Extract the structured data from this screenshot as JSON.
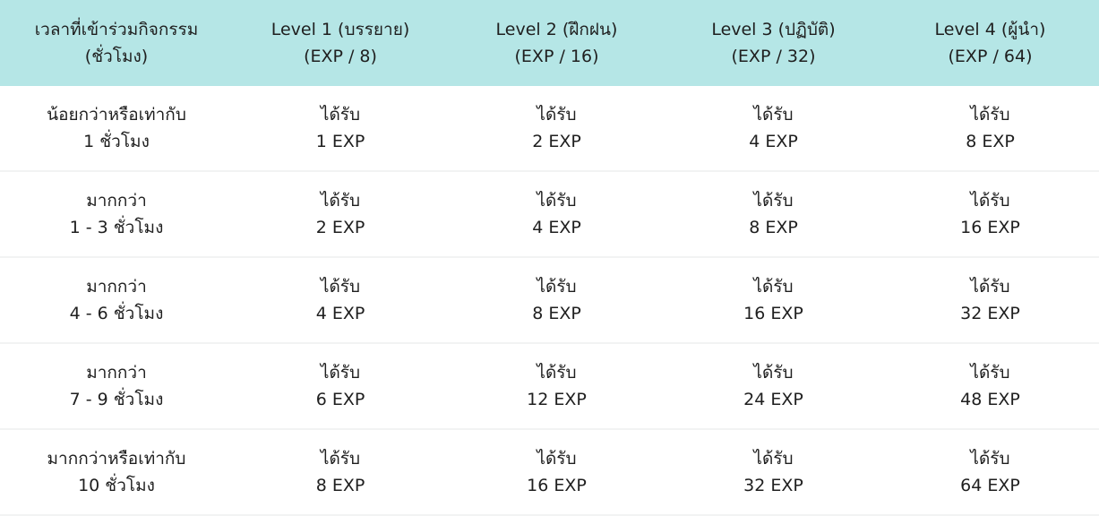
{
  "header": [
    {
      "line1": "เวลาที่เข้าร่วมกิจกรรม",
      "line2": "(ชั่วโมง)"
    },
    {
      "line1": "Level 1 (บรรยาย)",
      "line2": "(EXP / 8)"
    },
    {
      "line1": "Level 2 (ฝึกฝน)",
      "line2": "(EXP / 16)"
    },
    {
      "line1": "Level 3 (ปฏิบัติ)",
      "line2": "(EXP / 32)"
    },
    {
      "line1": "Level 4 (ผู้นำ)",
      "line2": "(EXP / 64)"
    }
  ],
  "rows": [
    {
      "duration": {
        "line1": "น้อยกว่าหรือเท่ากับ",
        "line2": "1 ชั่วโมง"
      },
      "cells": [
        {
          "line1": "ได้รับ",
          "line2": "1 EXP"
        },
        {
          "line1": "ได้รับ",
          "line2": "2 EXP"
        },
        {
          "line1": "ได้รับ",
          "line2": "4 EXP"
        },
        {
          "line1": "ได้รับ",
          "line2": "8 EXP"
        }
      ]
    },
    {
      "duration": {
        "line1": "มากกว่า",
        "line2": "1 - 3 ชั่วโมง"
      },
      "cells": [
        {
          "line1": "ได้รับ",
          "line2": "2 EXP"
        },
        {
          "line1": "ได้รับ",
          "line2": "4 EXP"
        },
        {
          "line1": "ได้รับ",
          "line2": "8 EXP"
        },
        {
          "line1": "ได้รับ",
          "line2": "16 EXP"
        }
      ]
    },
    {
      "duration": {
        "line1": "มากกว่า",
        "line2": "4 - 6 ชั่วโมง"
      },
      "cells": [
        {
          "line1": "ได้รับ",
          "line2": "4 EXP"
        },
        {
          "line1": "ได้รับ",
          "line2": "8 EXP"
        },
        {
          "line1": "ได้รับ",
          "line2": "16 EXP"
        },
        {
          "line1": "ได้รับ",
          "line2": "32 EXP"
        }
      ]
    },
    {
      "duration": {
        "line1": "มากกว่า",
        "line2": "7 - 9 ชั่วโมง"
      },
      "cells": [
        {
          "line1": "ได้รับ",
          "line2": "6 EXP"
        },
        {
          "line1": "ได้รับ",
          "line2": "12 EXP"
        },
        {
          "line1": "ได้รับ",
          "line2": "24 EXP"
        },
        {
          "line1": "ได้รับ",
          "line2": "48 EXP"
        }
      ]
    },
    {
      "duration": {
        "line1": "มากกว่าหรือเท่ากับ",
        "line2": "10 ชั่วโมง"
      },
      "cells": [
        {
          "line1": "ได้รับ",
          "line2": "8 EXP"
        },
        {
          "line1": "ได้รับ",
          "line2": "16 EXP"
        },
        {
          "line1": "ได้รับ",
          "line2": "32 EXP"
        },
        {
          "line1": "ได้รับ",
          "line2": "64 EXP"
        }
      ]
    }
  ],
  "colors": {
    "header_background": "#b5e6e6",
    "row_divider": "#f2f3f3",
    "text": "#1f1f1f"
  }
}
